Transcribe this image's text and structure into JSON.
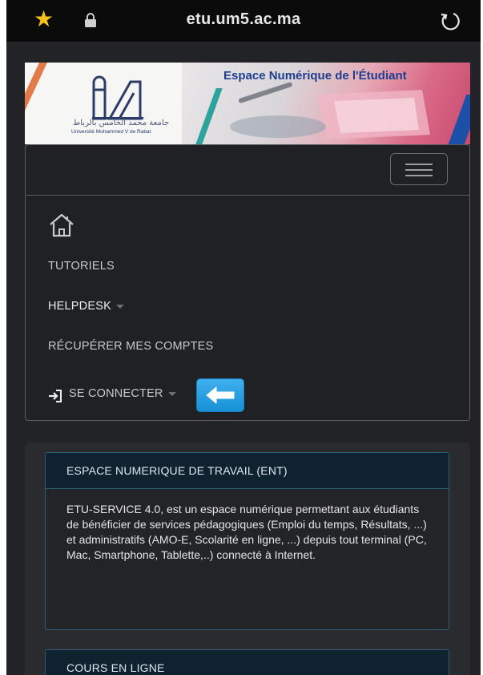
{
  "browser": {
    "url": "etu.um5.ac.ma",
    "star_icon": "star-icon",
    "lock_icon": "lock-icon",
    "reload_icon": "reload-icon"
  },
  "banner": {
    "title": "Espace Numérique de l'Étudiant",
    "university_arabic": "جامعة محمد الخامس بالرباط",
    "university_name": "Université Mohammed V de Rabat"
  },
  "nav": {
    "home_icon": "home-icon",
    "items": [
      {
        "label": "TUTORIELS"
      },
      {
        "label": "HELPDESK"
      },
      {
        "label": "RÉCUPÉRER MES COMPTES"
      },
      {
        "label": "SE CONNECTER"
      }
    ]
  },
  "cards": [
    {
      "title": "ESPACE NUMERIQUE DE TRAVAIL (ENT)",
      "body": "ETU-SERVICE 4.0, est un espace numérique permettant aux étudiants de bénéficier de services pédagogiques (Emploi du temps, Résultats, ...) et administratifs (AMO-E, Scolarité en ligne, ...) depuis tout terminal (PC, Mac, Smartphone, Tablette,..) connecté à Internet."
    },
    {
      "title": "COURS EN LIGNE"
    }
  ],
  "colors": {
    "star": "#f5c21a",
    "banner_title": "#1f3e8f",
    "card_border": "#2f5f78",
    "arrow_button": "#1790d6"
  }
}
